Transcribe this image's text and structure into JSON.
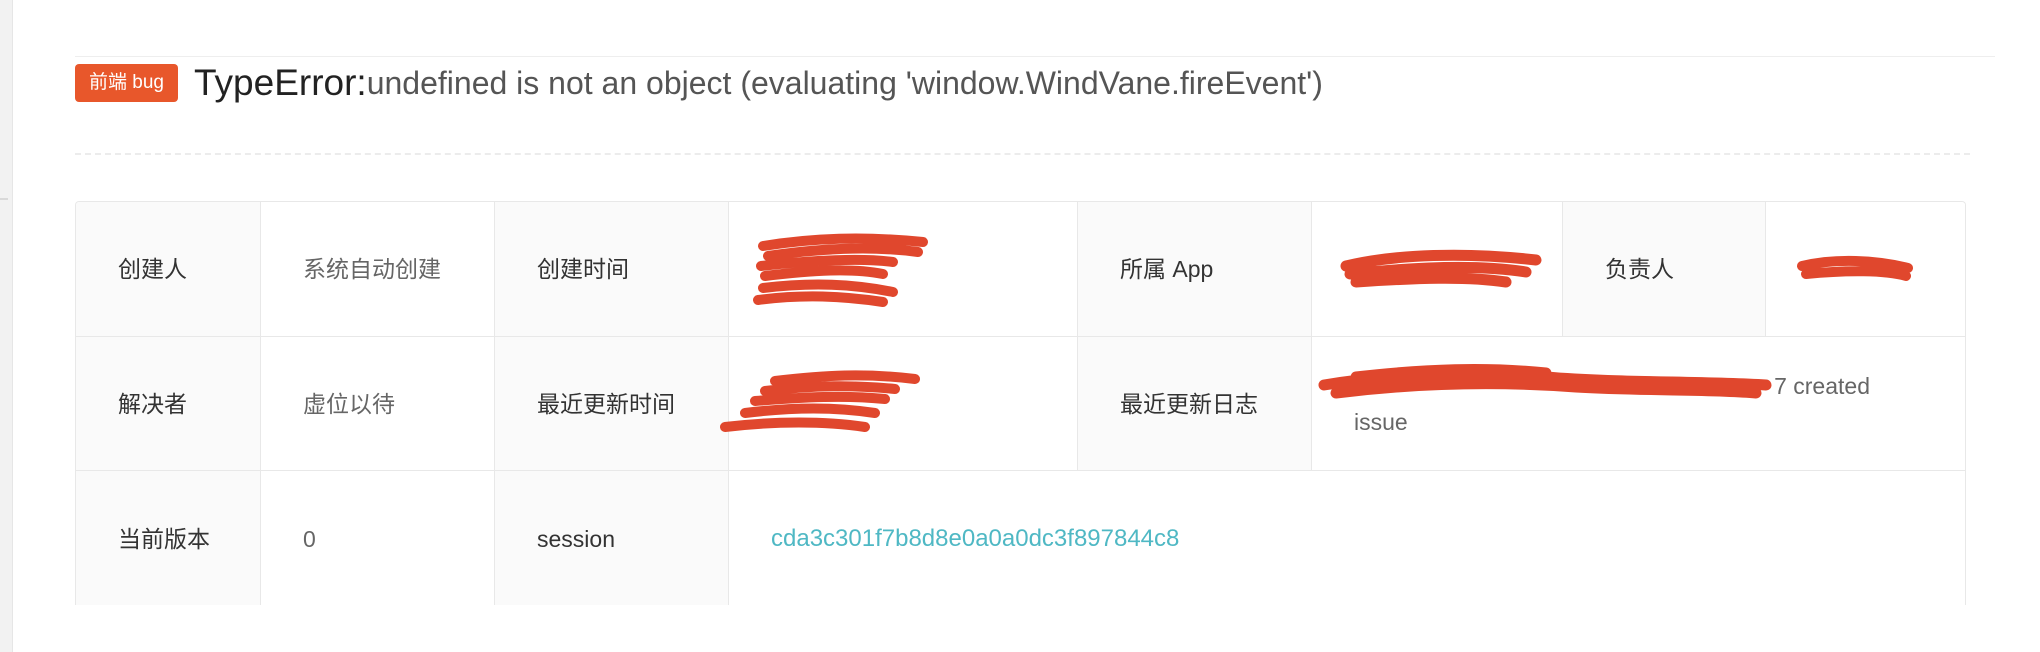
{
  "colors": {
    "tag_bg": "#e8572b",
    "link": "#4fb8c4",
    "redaction": "#e0472d"
  },
  "header": {
    "tag": "前端 bug",
    "error_type": "TypeError:",
    "error_message": "undefined is not an object (evaluating 'window.WindVane.fireEvent')"
  },
  "table": {
    "row1": {
      "creator_label": "创建人",
      "creator_value": "系统自动创建",
      "created_time_label": "创建时间",
      "created_time_value": "",
      "app_label": "所属 App",
      "app_value": "",
      "owner_label": "负责人",
      "owner_value": ""
    },
    "row2": {
      "resolver_label": "解决者",
      "resolver_value": "虚位以待",
      "updated_time_label": "最近更新时间",
      "updated_time_value": "",
      "update_log_label": "最近更新日志",
      "update_log_visible_tail": "7 created",
      "update_log_line2": "issue"
    },
    "row3": {
      "version_label": "当前版本",
      "version_value": "0",
      "session_label": "session",
      "session_value": "cda3c301f7b8d8e0a0a0dc3f897844c8"
    }
  }
}
